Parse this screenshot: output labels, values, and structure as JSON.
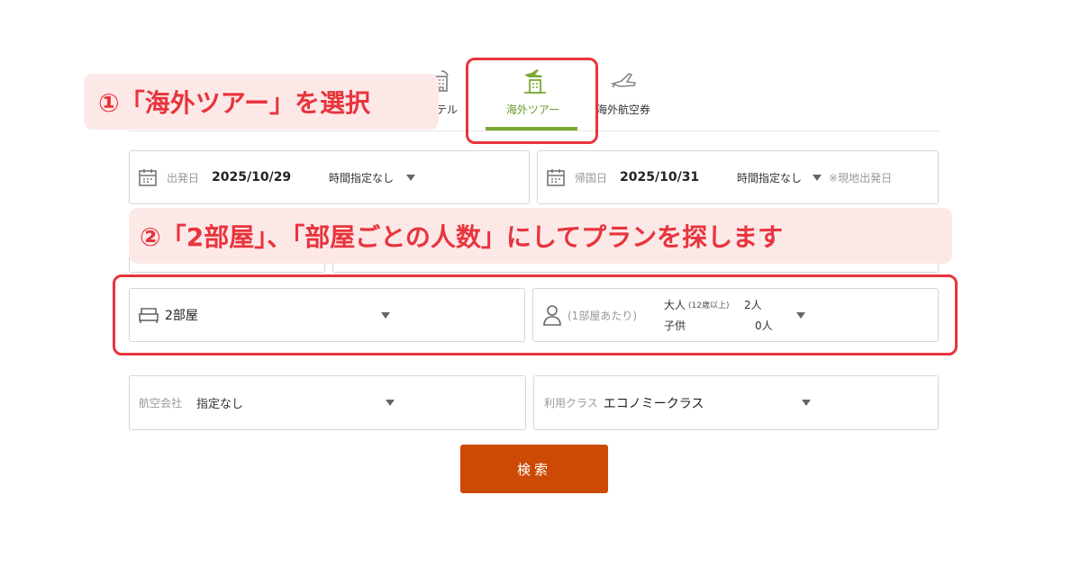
{
  "tabs": {
    "hotel": "ホテル",
    "tour": "海外ツアー",
    "air": "海外航空券"
  },
  "departure": {
    "caption": "出発日",
    "date": "2025/10/29",
    "time": "時間指定なし"
  },
  "return": {
    "caption": "帰国日",
    "date": "2025/10/31",
    "time": "時間指定なし",
    "note": "※現地出発日"
  },
  "rooms": {
    "value": "2部屋"
  },
  "guests": {
    "caption": "(1部屋あたり)",
    "adult_label": "大人",
    "adult_note": "(12歳以上)",
    "adult_count": "2人",
    "child_label": "子供",
    "child_count": "0人"
  },
  "airline": {
    "caption": "航空会社",
    "value": "指定なし"
  },
  "seat_class": {
    "caption": "利用クラス",
    "value": "エコノミークラス"
  },
  "search_button": "検索",
  "annotations": {
    "step1": "①「海外ツアー」を選択",
    "step2": "②「2部屋」、「部屋ごとの人数」にしてプランを探します"
  },
  "colors": {
    "accent_green": "#7ca834",
    "search_orange": "#cc4a05",
    "annotation_red": "#e8343c",
    "annotation_bg": "#fde8e8"
  },
  "icons": [
    "hotel-icon",
    "tour-plane-building-icon",
    "airplane-icon",
    "calendar-icon",
    "bed-icon",
    "person-icon",
    "dropdown-triangle-icon"
  ]
}
